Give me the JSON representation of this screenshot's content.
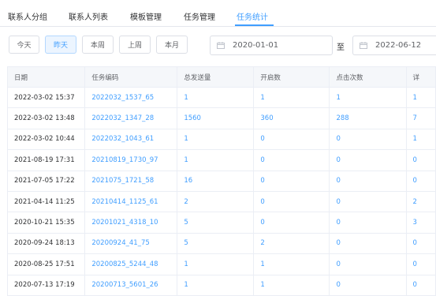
{
  "tabs": [
    {
      "label": "联系人分组"
    },
    {
      "label": "联系人列表"
    },
    {
      "label": "模板管理"
    },
    {
      "label": "任务管理"
    },
    {
      "label": "任务统计",
      "active": true
    }
  ],
  "filters": {
    "buttons": [
      {
        "label": "今天"
      },
      {
        "label": "昨天",
        "active": true
      },
      {
        "label": "本周"
      },
      {
        "label": "上周"
      },
      {
        "label": "本月"
      }
    ],
    "start_date": "2020-01-01",
    "to_label": "至",
    "end_date": "2022-06-12"
  },
  "table": {
    "columns": [
      "日期",
      "任务编码",
      "总发送量",
      "开启数",
      "点击次数",
      "详"
    ],
    "rows": [
      [
        "2022-03-02 15:37",
        "2022032_1537_65",
        "1",
        "1",
        "1",
        "1"
      ],
      [
        "2022-03-02 13:48",
        "2022032_1347_28",
        "1560",
        "360",
        "288",
        "7"
      ],
      [
        "2022-03-02 10:44",
        "2022032_1043_61",
        "1",
        "0",
        "0",
        "1"
      ],
      [
        "2021-08-19 17:31",
        "20210819_1730_97",
        "1",
        "0",
        "0",
        "0"
      ],
      [
        "2021-07-05 17:22",
        "2021075_1721_58",
        "16",
        "0",
        "0",
        "0"
      ],
      [
        "2021-04-14 11:25",
        "20210414_1125_61",
        "2",
        "0",
        "0",
        "2"
      ],
      [
        "2020-10-21 15:35",
        "20201021_4318_10",
        "5",
        "0",
        "0",
        "3"
      ],
      [
        "2020-09-24 18:13",
        "20200924_41_75",
        "5",
        "2",
        "0",
        "0"
      ],
      [
        "2020-08-25 17:51",
        "20200825_5244_48",
        "1",
        "1",
        "0",
        "0"
      ],
      [
        "2020-07-13 17:19",
        "20200713_5601_26",
        "1",
        "1",
        "0",
        "0"
      ]
    ]
  },
  "colors": {
    "accent": "#409eff",
    "border": "#ebeef5",
    "header_bg": "#f5f7fa"
  }
}
